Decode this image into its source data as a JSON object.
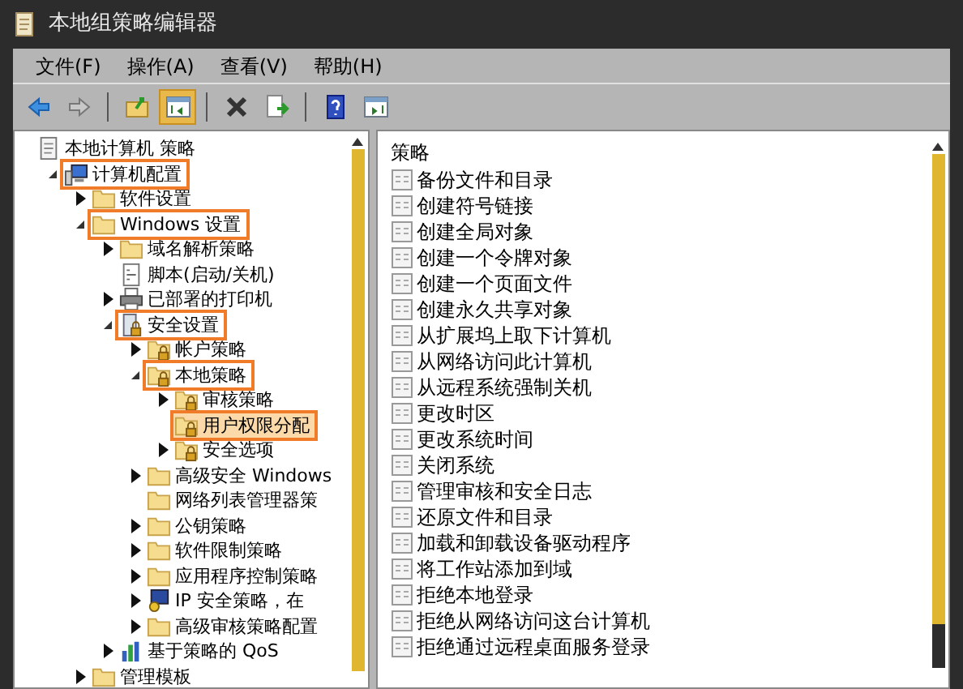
{
  "window": {
    "title": "本地组策略编辑器"
  },
  "menu": [
    "文件(F)",
    "操作(A)",
    "查看(V)",
    "帮助(H)"
  ],
  "toolbar": [
    {
      "kind": "back",
      "pressed": false
    },
    {
      "kind": "forward",
      "pressed": false
    },
    {
      "kind": "separator"
    },
    {
      "kind": "up",
      "pressed": false
    },
    {
      "kind": "tree-toggle",
      "pressed": true
    },
    {
      "kind": "separator"
    },
    {
      "kind": "delete",
      "pressed": false
    },
    {
      "kind": "export",
      "pressed": false
    },
    {
      "kind": "separator"
    },
    {
      "kind": "help",
      "pressed": false
    },
    {
      "kind": "pane-toggle",
      "pressed": false
    }
  ],
  "tree": [
    {
      "label": "本地计算机 策略",
      "kind": "policy",
      "highlighted": false,
      "selected": false,
      "children": [
        {
          "label": "计算机配置",
          "kind": "computer",
          "expanded": true,
          "highlighted": true,
          "selected": false,
          "children": [
            {
              "label": "软件设置",
              "kind": "folder",
              "expanded": false,
              "highlighted": false,
              "selected": false
            },
            {
              "label": "Windows 设置",
              "kind": "folder",
              "expanded": true,
              "highlighted": true,
              "selected": false,
              "children": [
                {
                  "label": "域名解析策略",
                  "kind": "folder",
                  "expanded": false,
                  "highlighted": false,
                  "selected": false
                },
                {
                  "label": "脚本(启动/关机)",
                  "kind": "script",
                  "highlighted": false,
                  "selected": false
                },
                {
                  "label": "已部署的打印机",
                  "kind": "printer",
                  "expanded": false,
                  "highlighted": false,
                  "selected": false
                },
                {
                  "label": "安全设置",
                  "kind": "security",
                  "expanded": true,
                  "highlighted": true,
                  "selected": false,
                  "children": [
                    {
                      "label": "帐户策略",
                      "kind": "locked-folder",
                      "expanded": false,
                      "highlighted": false,
                      "selected": false
                    },
                    {
                      "label": "本地策略",
                      "kind": "locked-folder",
                      "expanded": true,
                      "highlighted": true,
                      "selected": false,
                      "children": [
                        {
                          "label": "审核策略",
                          "kind": "locked-folder",
                          "expanded": false,
                          "highlighted": false,
                          "selected": false
                        },
                        {
                          "label": "用户权限分配",
                          "kind": "locked-folder",
                          "highlighted": true,
                          "selected": true
                        },
                        {
                          "label": "安全选项",
                          "kind": "locked-folder",
                          "expanded": false,
                          "highlighted": false,
                          "selected": false
                        }
                      ]
                    },
                    {
                      "label": "高级安全 Windows",
                      "kind": "folder",
                      "expanded": false,
                      "highlighted": false,
                      "selected": false
                    },
                    {
                      "label": "网络列表管理器策",
                      "kind": "folder",
                      "highlighted": false,
                      "selected": false
                    },
                    {
                      "label": "公钥策略",
                      "kind": "folder",
                      "expanded": false,
                      "highlighted": false,
                      "selected": false
                    },
                    {
                      "label": "软件限制策略",
                      "kind": "folder",
                      "expanded": false,
                      "highlighted": false,
                      "selected": false
                    },
                    {
                      "label": "应用程序控制策略",
                      "kind": "folder",
                      "expanded": false,
                      "highlighted": false,
                      "selected": false
                    },
                    {
                      "label": "IP 安全策略，在",
                      "kind": "network",
                      "expanded": false,
                      "highlighted": false,
                      "selected": false
                    },
                    {
                      "label": "高级审核策略配置",
                      "kind": "folder",
                      "expanded": false,
                      "highlighted": false,
                      "selected": false
                    }
                  ]
                },
                {
                  "label": "基于策略的 QoS",
                  "kind": "chart",
                  "expanded": false,
                  "highlighted": false,
                  "selected": false
                }
              ]
            },
            {
              "label": "管理模板",
              "kind": "folder",
              "expanded": false,
              "highlighted": false,
              "selected": false
            }
          ]
        }
      ]
    }
  ],
  "list": {
    "header": "策略",
    "items": [
      "备份文件和目录",
      "创建符号链接",
      "创建全局对象",
      "创建一个令牌对象",
      "创建一个页面文件",
      "创建永久共享对象",
      "从扩展坞上取下计算机",
      "从网络访问此计算机",
      "从远程系统强制关机",
      "更改时区",
      "更改系统时间",
      "关闭系统",
      "管理审核和安全日志",
      "还原文件和目录",
      "加载和卸载设备驱动程序",
      "将工作站添加到域",
      "拒绝本地登录",
      "拒绝从网络访问这台计算机",
      "拒绝通过远程桌面服务登录"
    ]
  }
}
